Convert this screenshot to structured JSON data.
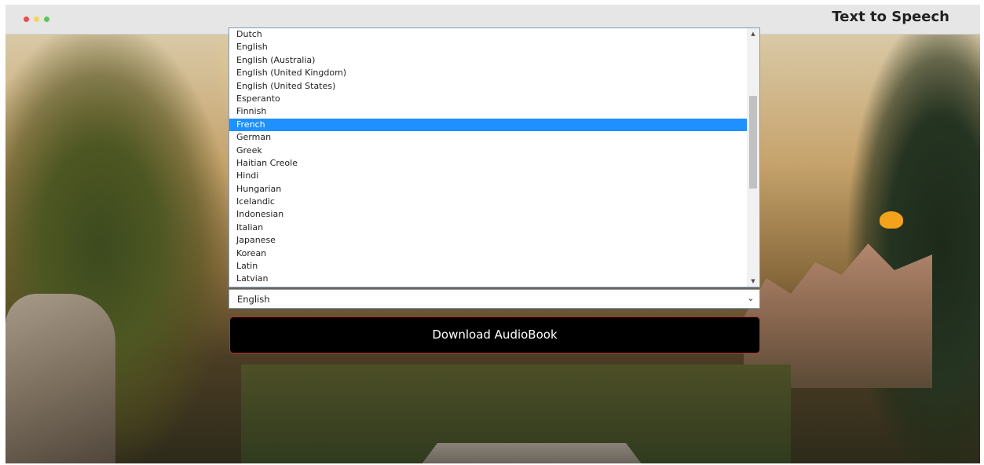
{
  "window": {
    "title": "Text to Speech"
  },
  "language_select": {
    "value": "English",
    "selected_option": "French",
    "options": [
      "Dutch",
      "English",
      "English (Australia)",
      "English (United Kingdom)",
      "English (United States)",
      "Esperanto",
      "Finnish",
      "French",
      "German",
      "Greek",
      "Haitian Creole",
      "Hindi",
      "Hungarian",
      "Icelandic",
      "Indonesian",
      "Italian",
      "Japanese",
      "Korean",
      "Latin",
      "Latvian"
    ]
  },
  "download_button": {
    "label": "Download AudioBook"
  },
  "icons": {
    "close": "close-dot-icon",
    "minimize": "minimize-dot-icon",
    "maximize": "maximize-dot-icon",
    "chevron": "chevron-down-icon",
    "scroll_up": "scroll-up-arrow-icon",
    "scroll_down": "scroll-down-arrow-icon"
  },
  "colors": {
    "selection": "#1e90ff",
    "button_bg": "#000000",
    "button_border": "#b0313a"
  }
}
